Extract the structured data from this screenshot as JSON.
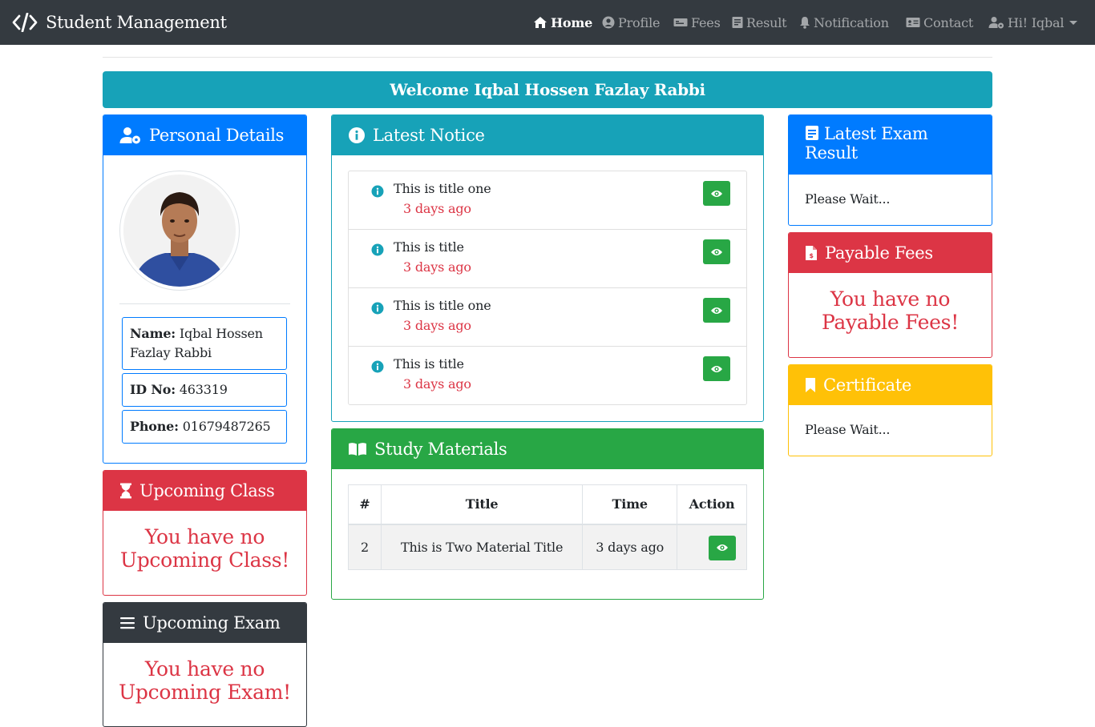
{
  "navbar": {
    "brand": "Student Management",
    "items": [
      {
        "label": "Home",
        "icon": "home-icon"
      },
      {
        "label": "Profile",
        "icon": "user-circle-icon"
      },
      {
        "label": "Fees",
        "icon": "money-icon"
      },
      {
        "label": "Result",
        "icon": "file-icon"
      },
      {
        "label": "Notification",
        "icon": "bell-icon"
      },
      {
        "label": "Contact",
        "icon": "address-card-icon"
      },
      {
        "label": "Hi! Iqbal",
        "icon": "user-cog-icon"
      }
    ]
  },
  "welcome": "Welcome Iqbal Hossen Fazlay Rabbi",
  "personal": {
    "title": "Personal Details",
    "name_label": "Name:",
    "name": "Iqbal Hossen Fazlay Rabbi",
    "id_label": "ID No:",
    "id": "463319",
    "phone_label": "Phone:",
    "phone": "01679487265"
  },
  "upcoming_class": {
    "title": "Upcoming Class",
    "message": "You have no Upcoming Class!"
  },
  "upcoming_exam": {
    "title": "Upcoming Exam",
    "message": "You have no Upcoming Exam!"
  },
  "notice": {
    "title": "Latest Notice",
    "items": [
      {
        "title": "This is title one",
        "time": "3 days ago"
      },
      {
        "title": "This is title",
        "time": "3 days ago"
      },
      {
        "title": "This is title one",
        "time": "3 days ago"
      },
      {
        "title": "This is title",
        "time": "3 days ago"
      }
    ]
  },
  "materials": {
    "title": "Study Materials",
    "headers": [
      "#",
      "Title",
      "Time",
      "Action"
    ],
    "rows": [
      {
        "num": "2",
        "title": "This is Two Material Title",
        "time": "3 days ago"
      }
    ]
  },
  "exam_result": {
    "title": "Latest Exam Result",
    "text": "Please Wait..."
  },
  "fees": {
    "title": "Payable Fees",
    "message": "You have no Payable Fees!"
  },
  "certificate": {
    "title": "Certificate",
    "text": "Please Wait..."
  },
  "colors": {
    "navbar": "#343a40",
    "primary": "#007bff",
    "info": "#17a2b8",
    "danger": "#dc3545",
    "success": "#28a745",
    "warning": "#ffc107"
  }
}
